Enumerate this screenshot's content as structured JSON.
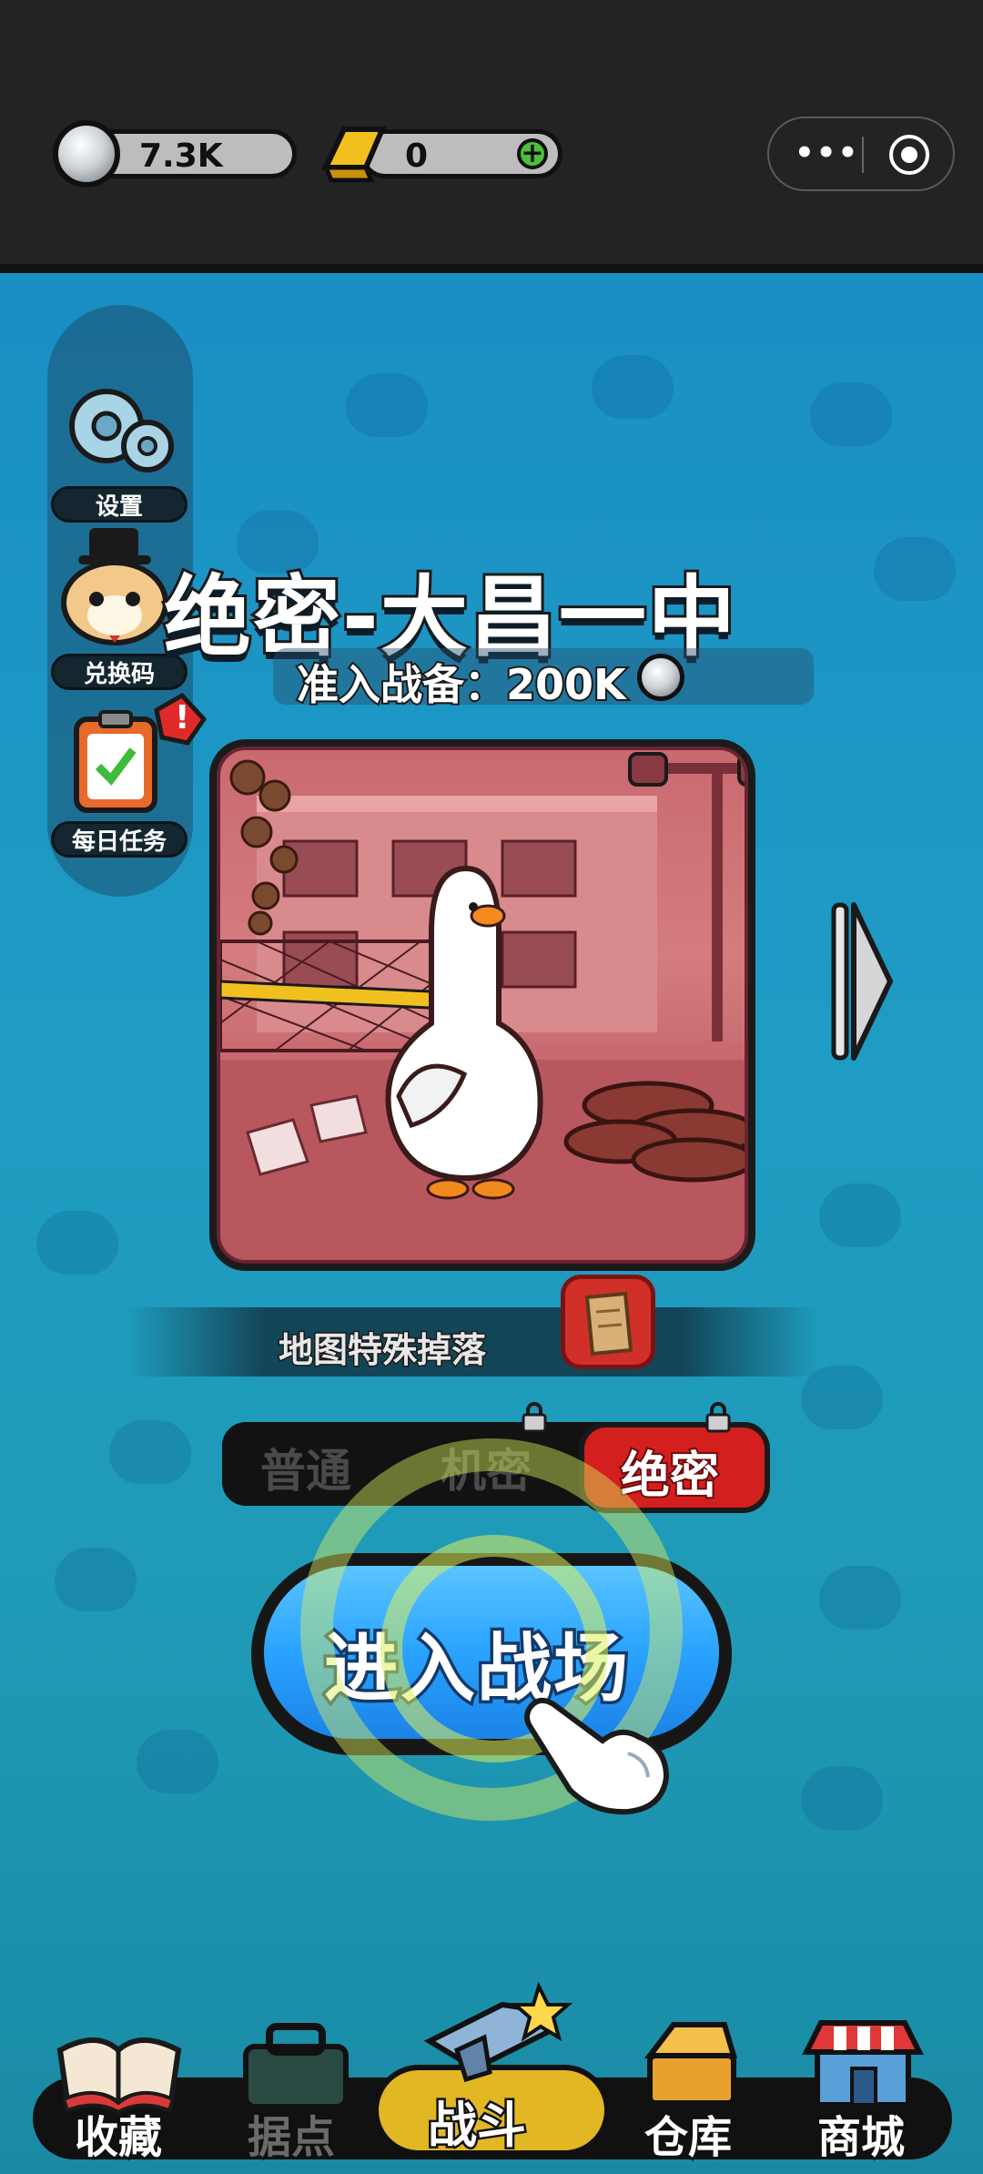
{
  "topbar": {
    "silver": "7.3K",
    "gold": "0",
    "plus": "+",
    "menu_dots": "•••"
  },
  "side_menu": {
    "items": [
      {
        "label": "设置",
        "icon": "gear-icon"
      },
      {
        "label": "兑换码",
        "icon": "hamster-icon"
      },
      {
        "label": "每日任务",
        "icon": "clipboard-icon"
      }
    ],
    "alert": "!"
  },
  "map": {
    "title": "绝密-大昌一中",
    "requirement": "准入战备：200K"
  },
  "drop": {
    "label": "地图特殊掉落"
  },
  "difficulty": {
    "options": [
      "普通",
      "机密",
      "绝密"
    ],
    "selected": "绝密"
  },
  "enter_button": {
    "label": "进入战场"
  },
  "nav": {
    "items": [
      "收藏",
      "据点",
      "战斗",
      "仓库",
      "商城"
    ],
    "active": "战斗"
  },
  "colors": {
    "accent_blue": "#2aa3ff",
    "selected_red": "#d41f1f",
    "nav_active": "#e1b723"
  }
}
